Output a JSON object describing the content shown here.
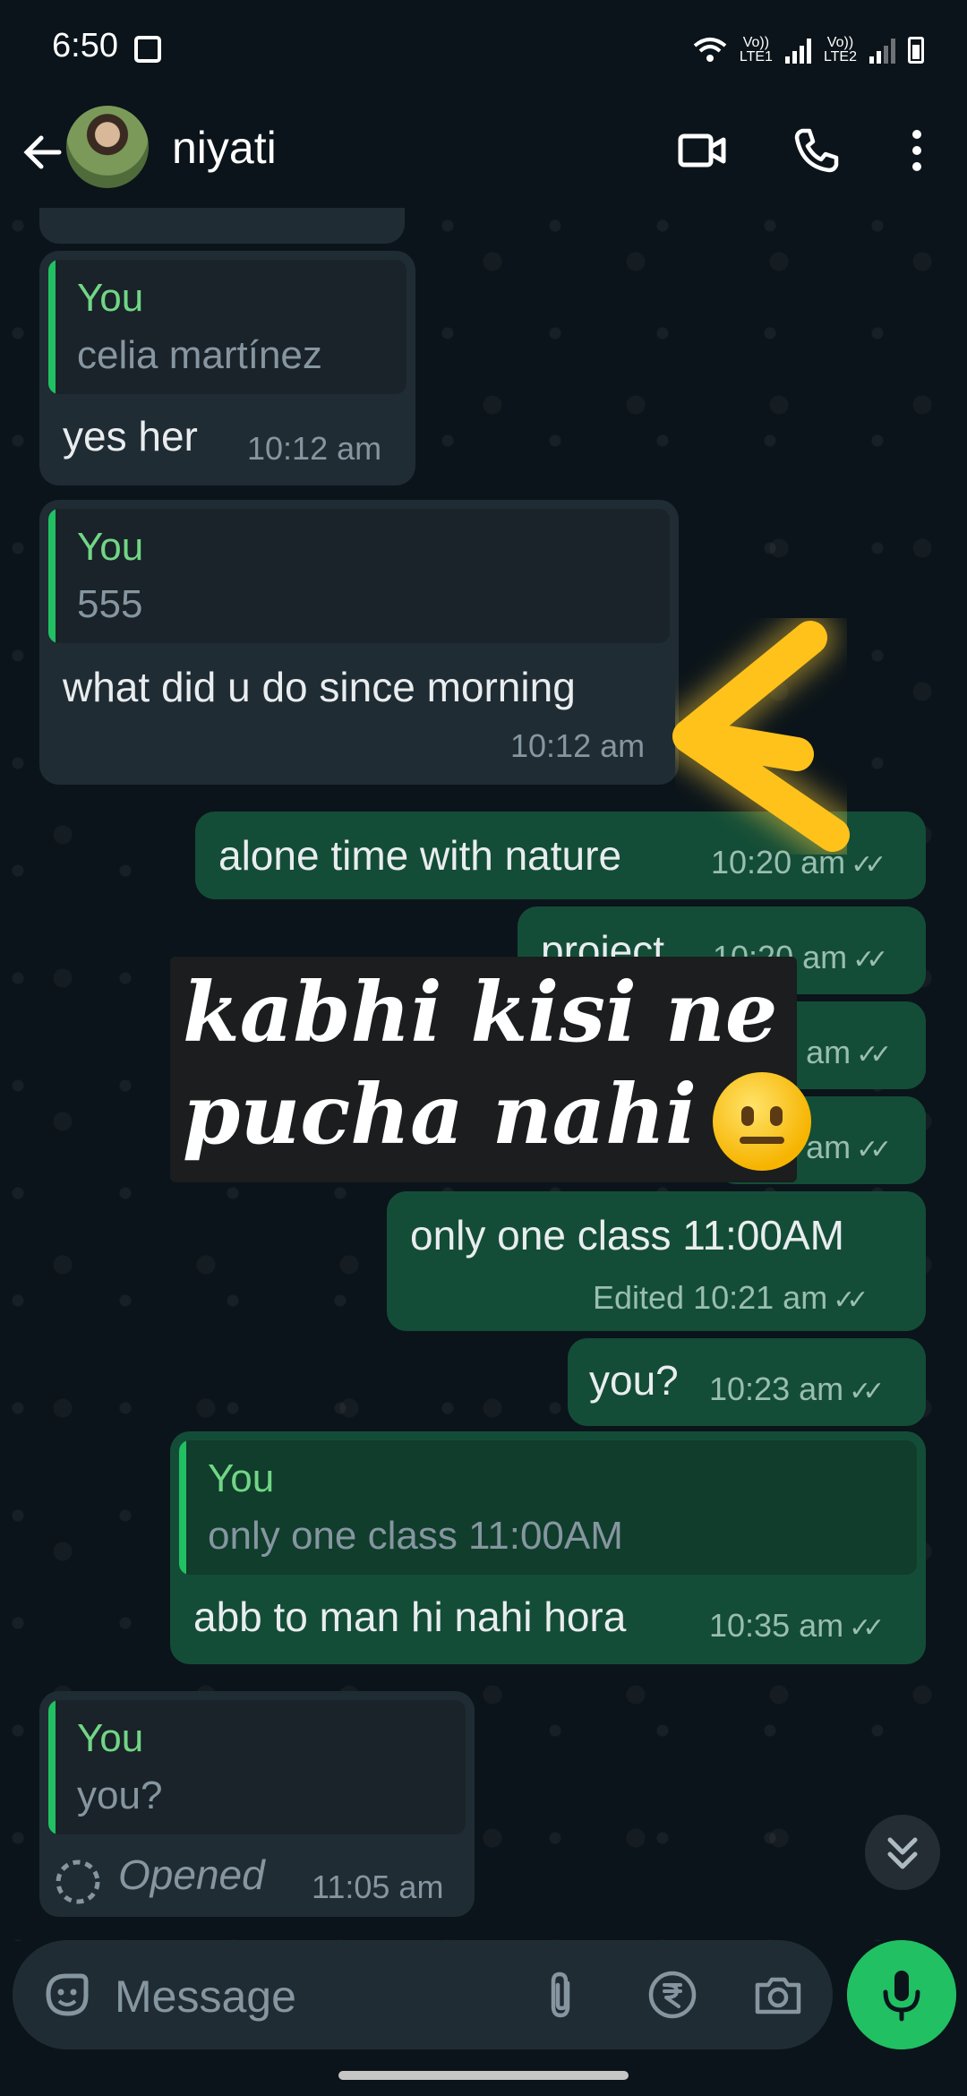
{
  "status": {
    "time": "6:50",
    "lte1": "LTE1",
    "lte2": "LTE2",
    "vo": "Vo))"
  },
  "header": {
    "contact_name": "niyati"
  },
  "messages": [
    {
      "type": "in",
      "quote_name": "You",
      "quote_text": "celia martínez",
      "text": "yes her",
      "time": "10:12 am"
    },
    {
      "type": "in",
      "quote_name": "You",
      "quote_text": "555",
      "text": "what did u do since morning",
      "time": "10:12 am"
    },
    {
      "type": "out",
      "text": "alone time with nature",
      "time": "10:20 am"
    },
    {
      "type": "out",
      "text": "project",
      "time": "10:20 am"
    },
    {
      "type": "out",
      "text": "",
      "time": "10:20 am"
    },
    {
      "type": "out",
      "text": "",
      "time": "10:20 am"
    },
    {
      "type": "out",
      "text": "only one class 11:00AM",
      "edited": "Edited",
      "time": "10:21 am"
    },
    {
      "type": "out",
      "text": "you?",
      "time": "10:23 am"
    },
    {
      "type": "out",
      "quote_name": "You",
      "quote_text": "only one class 11:00AM",
      "text": "abb to man hi nahi hora",
      "time": "10:35 am"
    },
    {
      "type": "in",
      "quote_name": "You",
      "quote_text": "you?",
      "text": "Opened",
      "time": "11:05 am"
    }
  ],
  "sticker": {
    "line1": "kabhi kisi ne",
    "line2": "pucha nahi",
    "emoji": "neutral-face"
  },
  "input": {
    "placeholder": "Message"
  },
  "colors": {
    "accent": "#21c063",
    "out_bubble": "#144d37",
    "in_bubble": "#202c33",
    "highlight_arrow": "#ffc21a"
  },
  "icons": [
    "back-arrow-icon",
    "video-call-icon",
    "phone-icon",
    "more-vert-icon",
    "sticker-icon",
    "attach-icon",
    "rupee-icon",
    "camera-icon",
    "mic-icon",
    "chevron-double-down-icon",
    "view-once-icon"
  ]
}
